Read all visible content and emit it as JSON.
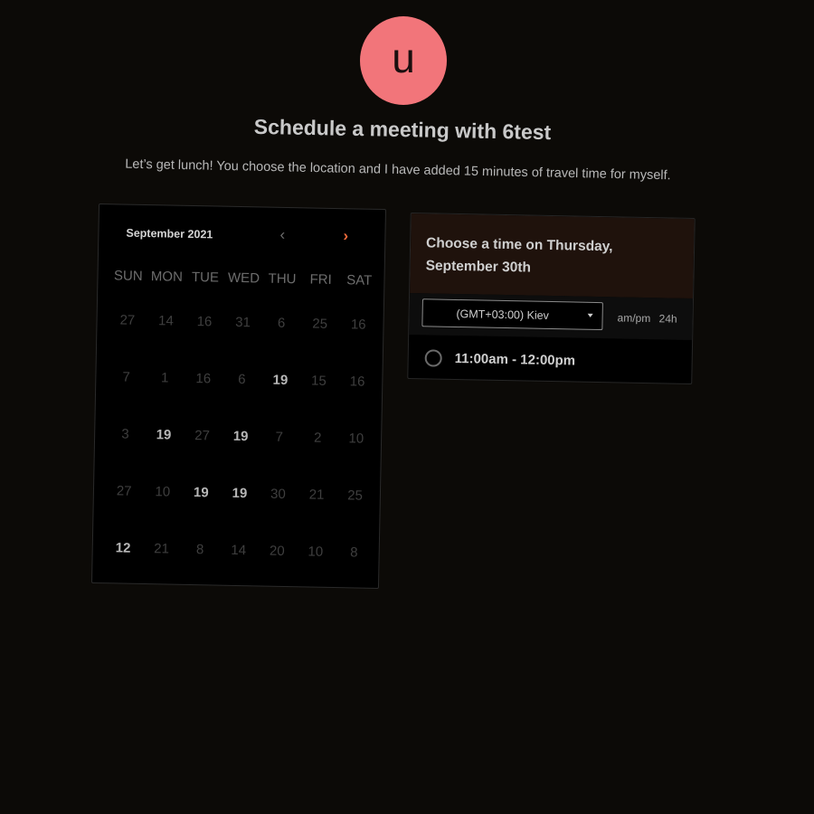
{
  "avatar": {
    "letter": "u",
    "color": "#f2757a"
  },
  "header": {
    "title": "Schedule a meeting with 6test",
    "description": "Let’s get lunch! You choose the location and I have added 15 minutes of travel time for myself."
  },
  "calendar": {
    "month_label": "September 2021",
    "prev_icon": "chevron-left-icon",
    "next_icon": "chevron-right-icon",
    "accent_color": "#ef6a3b",
    "weekdays": [
      "SUN",
      "MON",
      "TUE",
      "WED",
      "THU",
      "FRI",
      "SAT"
    ],
    "weeks": [
      [
        {
          "day": "27",
          "available": false
        },
        {
          "day": "14",
          "available": false
        },
        {
          "day": "16",
          "available": false
        },
        {
          "day": "31",
          "available": false
        },
        {
          "day": "6",
          "available": false
        },
        {
          "day": "25",
          "available": false
        },
        {
          "day": "16",
          "available": false
        }
      ],
      [
        {
          "day": "7",
          "available": false
        },
        {
          "day": "1",
          "available": false
        },
        {
          "day": "16",
          "available": false
        },
        {
          "day": "6",
          "available": false
        },
        {
          "day": "19",
          "available": true
        },
        {
          "day": "15",
          "available": false
        },
        {
          "day": "16",
          "available": false
        }
      ],
      [
        {
          "day": "3",
          "available": false
        },
        {
          "day": "19",
          "available": true
        },
        {
          "day": "27",
          "available": false
        },
        {
          "day": "19",
          "available": true
        },
        {
          "day": "7",
          "available": false
        },
        {
          "day": "2",
          "available": false
        },
        {
          "day": "10",
          "available": false
        }
      ],
      [
        {
          "day": "27",
          "available": false
        },
        {
          "day": "10",
          "available": false
        },
        {
          "day": "19",
          "available": true
        },
        {
          "day": "19",
          "available": true
        },
        {
          "day": "30",
          "available": false
        },
        {
          "day": "21",
          "available": false
        },
        {
          "day": "25",
          "available": false
        }
      ],
      [
        {
          "day": "12",
          "available": true
        },
        {
          "day": "21",
          "available": false
        },
        {
          "day": "8",
          "available": false
        },
        {
          "day": "14",
          "available": false
        },
        {
          "day": "20",
          "available": false
        },
        {
          "day": "10",
          "available": false
        },
        {
          "day": "8",
          "available": false
        }
      ]
    ]
  },
  "time_panel": {
    "heading_line1": "Choose a time on Thursday,",
    "heading_line2": "September 30th",
    "timezone": "(GMT+03:00) Kiev",
    "format_ampm": "am/pm",
    "format_24h": "24h",
    "slots": [
      {
        "label": "11:00am - 12:00pm"
      }
    ]
  }
}
